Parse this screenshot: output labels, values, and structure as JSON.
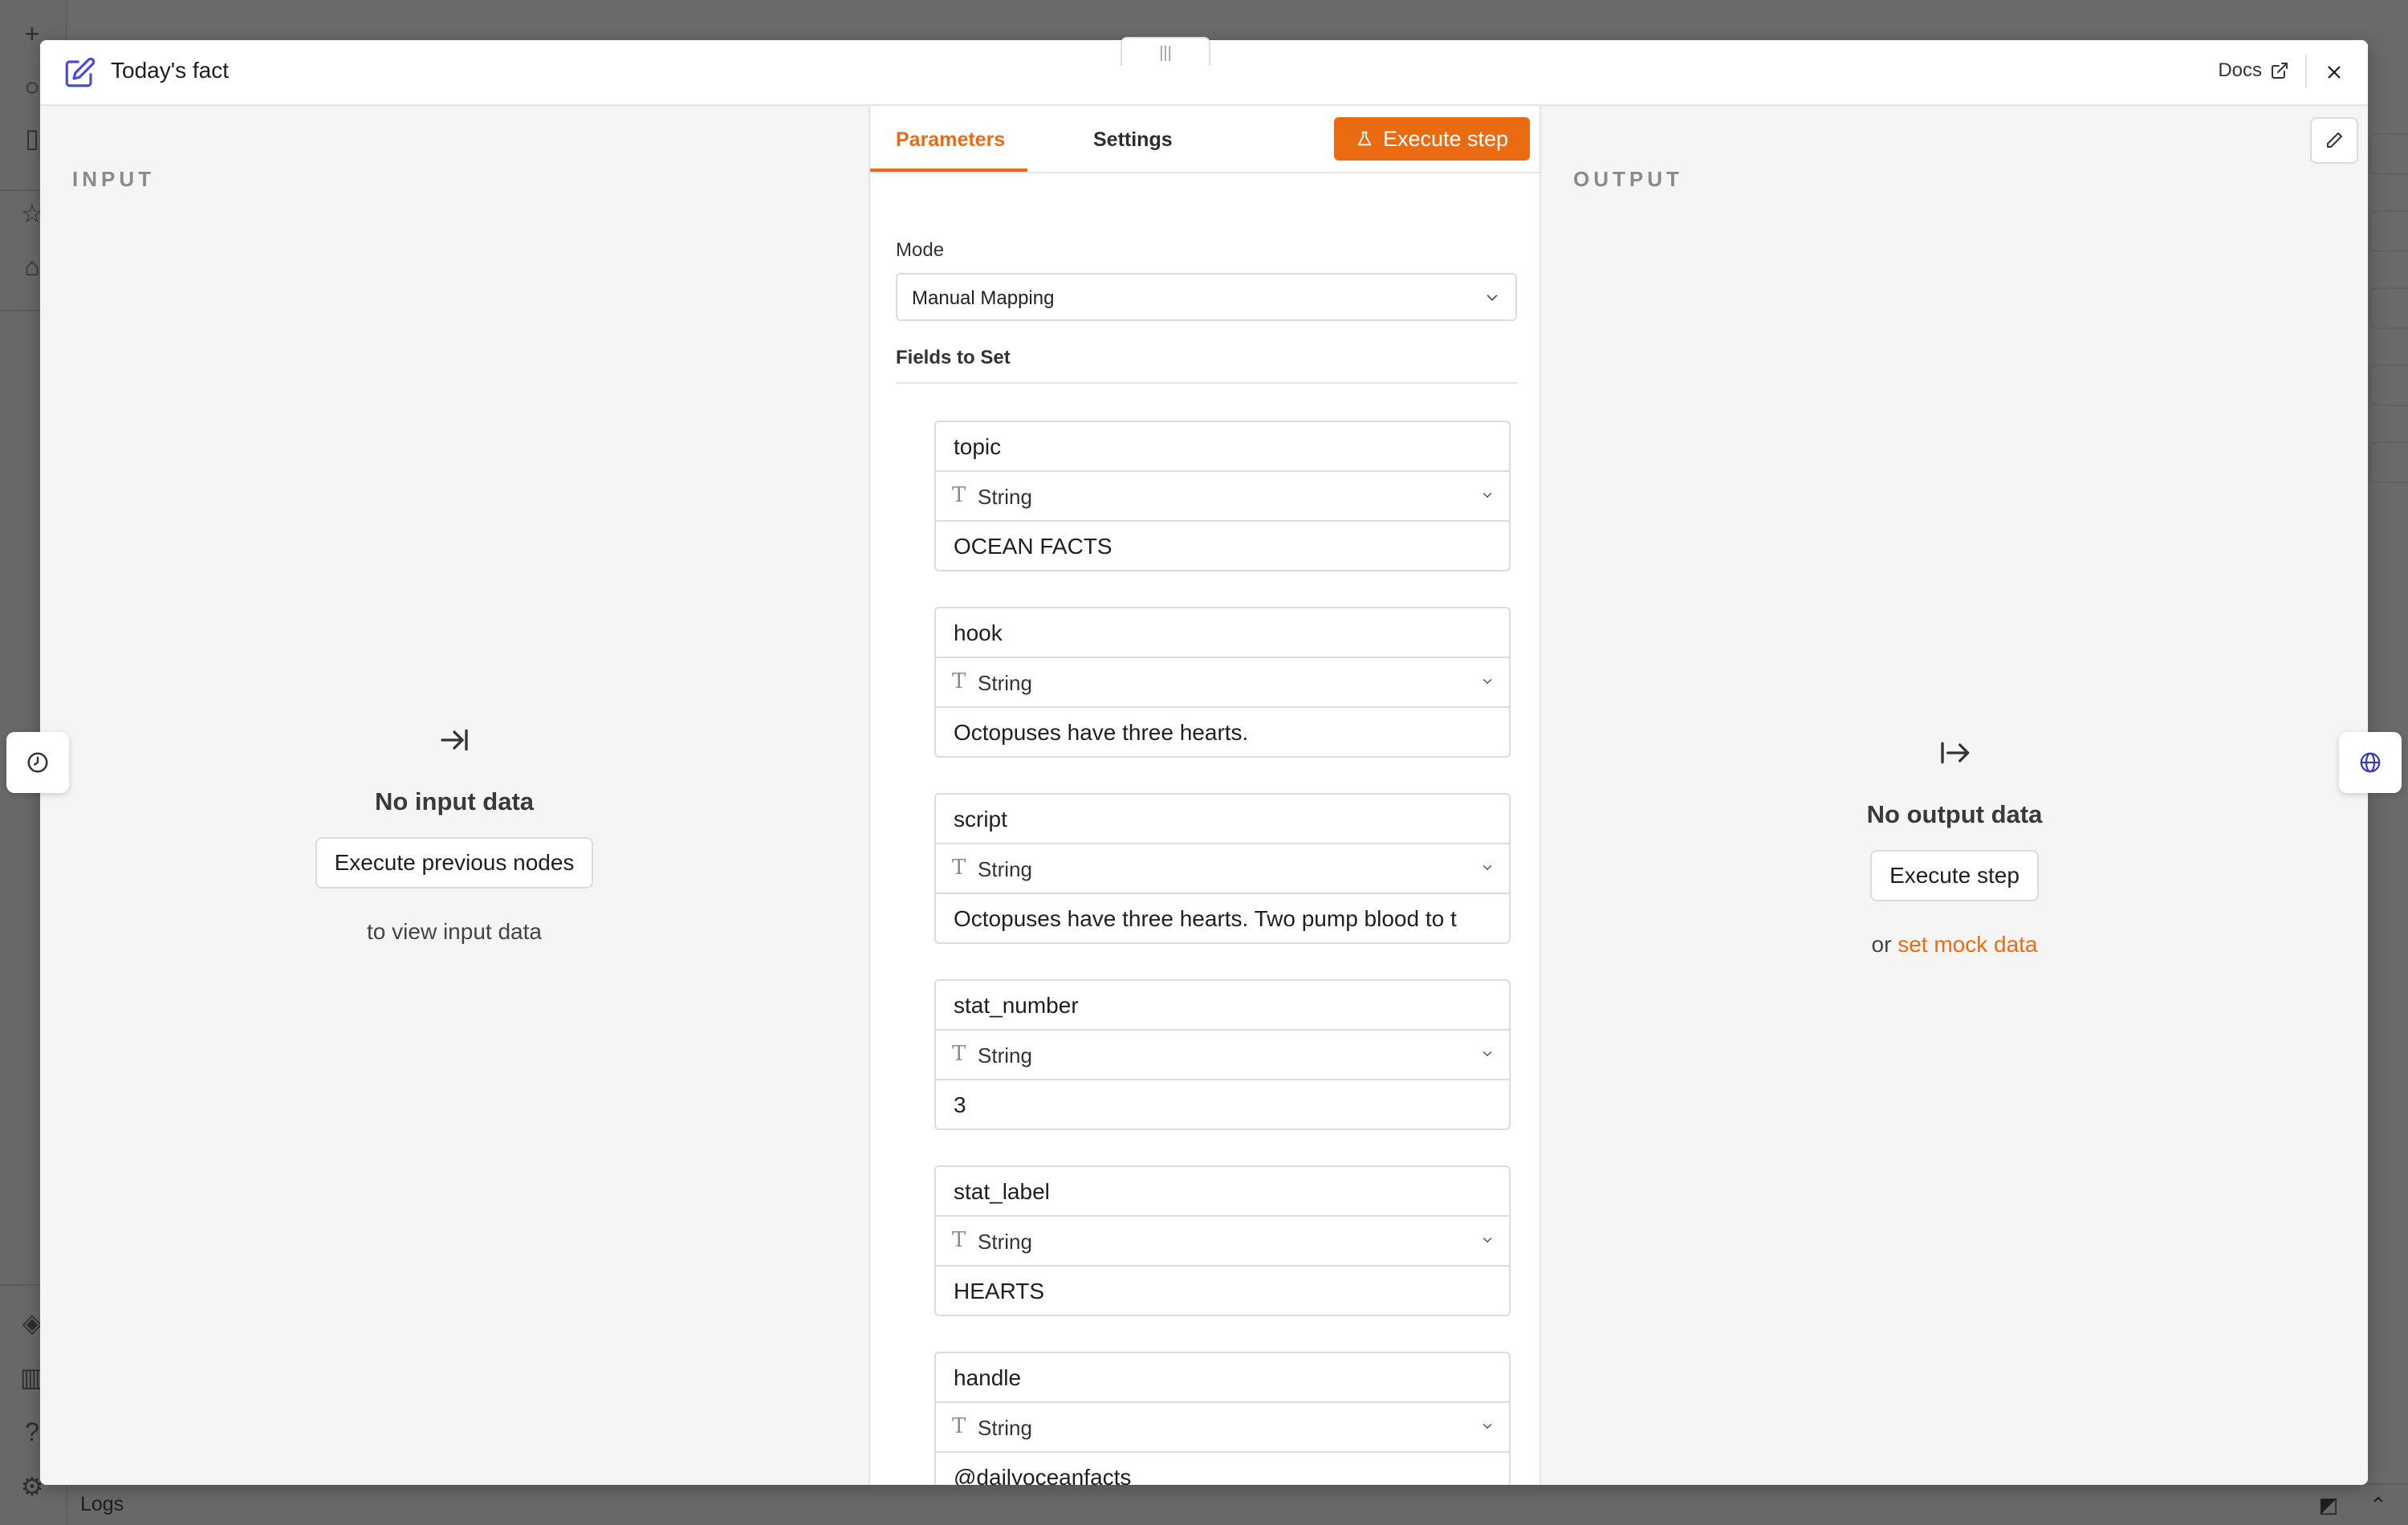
{
  "modal": {
    "title": "Today's fact",
    "docs_label": "Docs"
  },
  "input": {
    "label": "INPUT",
    "empty_title": "No input data",
    "button": "Execute previous nodes",
    "sub": "to view input data"
  },
  "output": {
    "label": "OUTPUT",
    "empty_title": "No output data",
    "button": "Execute step",
    "sub_prefix": "or",
    "sub_link": "set mock data"
  },
  "center": {
    "tabs": [
      "Parameters",
      "Settings"
    ],
    "execute_label": "Execute step",
    "mode_label": "Mode",
    "mode_value": "Manual Mapping",
    "fields_label": "Fields to Set",
    "fields": [
      {
        "name": "topic",
        "type": "String",
        "value": "OCEAN FACTS"
      },
      {
        "name": "hook",
        "type": "String",
        "value": "Octopuses have three hearts."
      },
      {
        "name": "script",
        "type": "String",
        "value": "Octopuses have three hearts. Two pump blood to t"
      },
      {
        "name": "stat_number",
        "type": "String",
        "value": "3"
      },
      {
        "name": "stat_label",
        "type": "String",
        "value": "HEARTS"
      },
      {
        "name": "handle",
        "type": "String",
        "value": "@dailyoceanfacts"
      }
    ]
  },
  "background": {
    "logs_label": "Logs"
  },
  "colors": {
    "accent": "#ea6b12",
    "panel_bg": "#f5f5f5",
    "overlay": "#6b6b6b"
  }
}
